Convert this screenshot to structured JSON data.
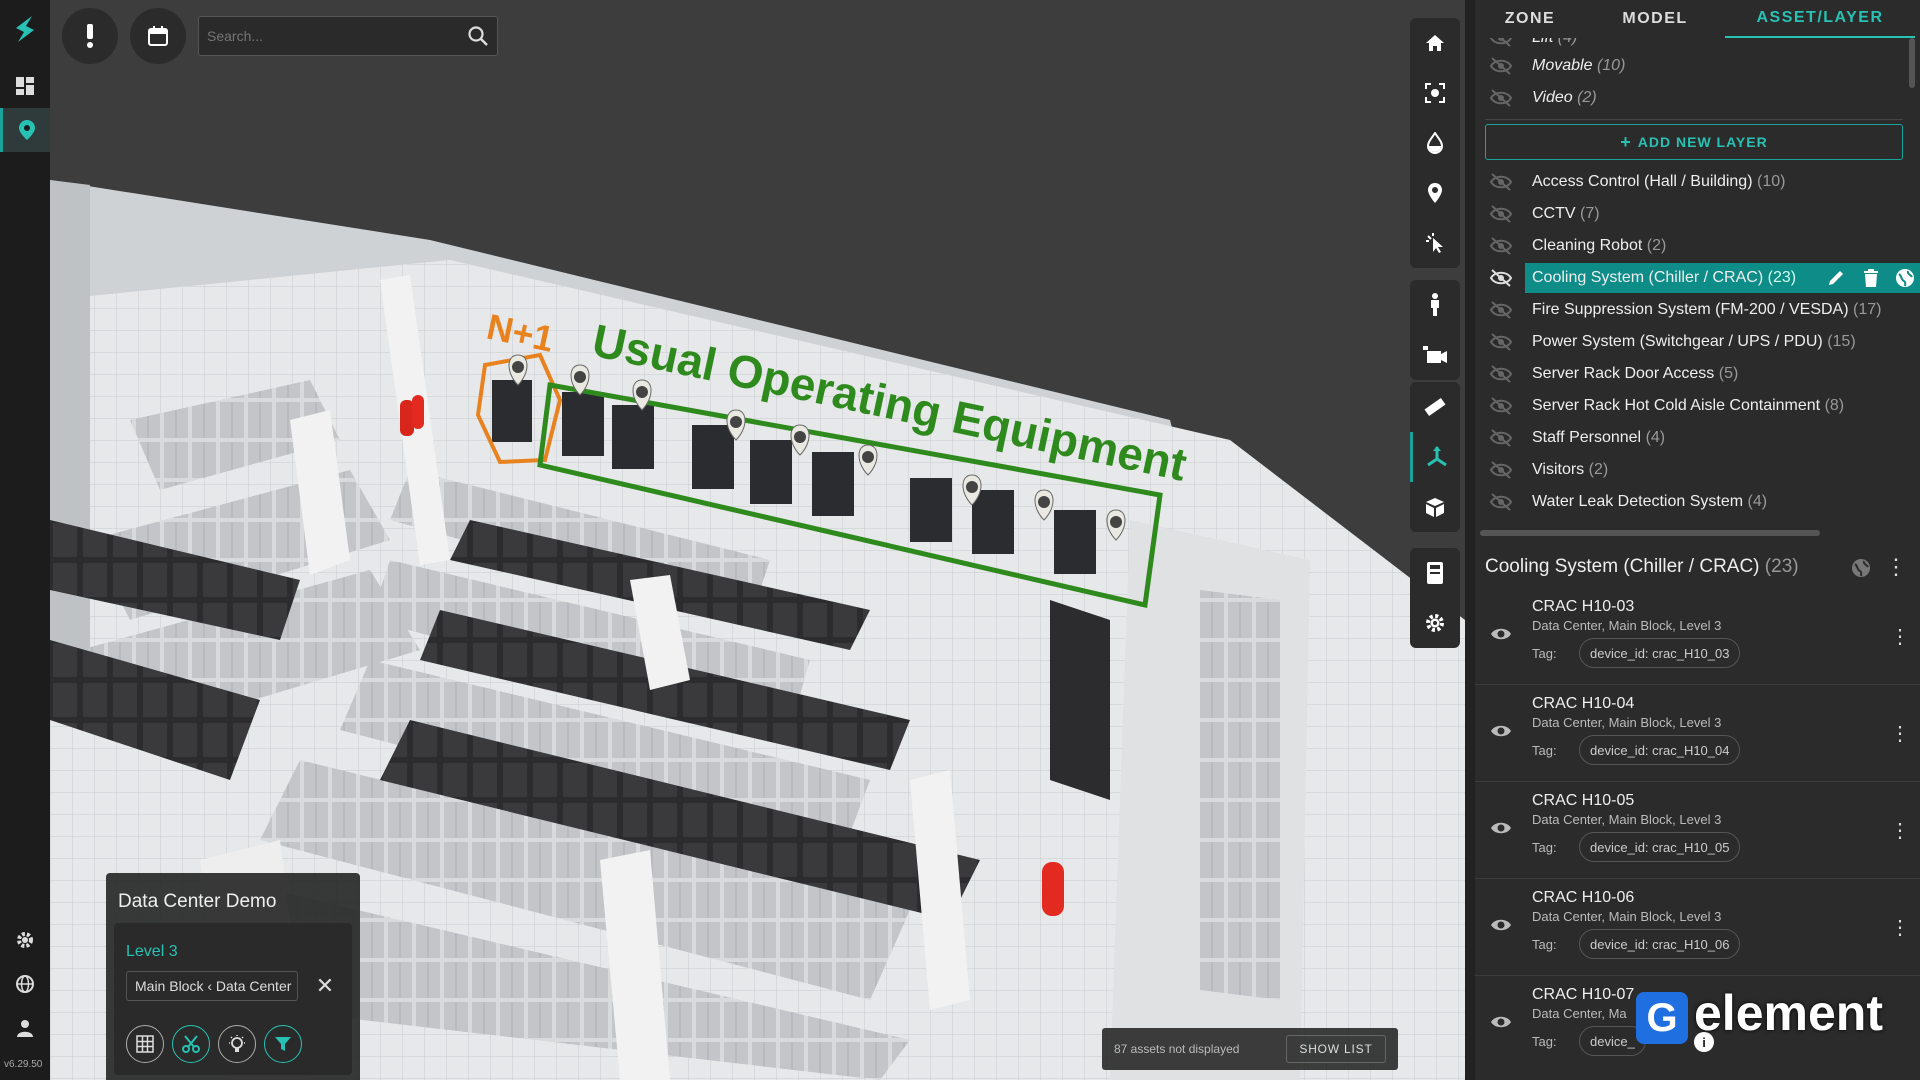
{
  "app": {
    "version": "v6.29.50"
  },
  "rail": {
    "items": [
      "dashboard-icon",
      "location-pin-icon"
    ],
    "bottom": [
      "settings-icon",
      "globe-icon",
      "user-icon"
    ]
  },
  "topbar": {
    "search_placeholder": "Search..."
  },
  "scene": {
    "annotations": {
      "n1": "N+1",
      "usual": "Usual Operating Equipment"
    },
    "colors": {
      "n1": "#e8821e",
      "usual": "#2f8a1e"
    }
  },
  "map_toolbar": [
    "home-icon",
    "focus-icon",
    "drop-icon",
    "pin-icon",
    "pointer-icon",
    "person-icon",
    "camera-icon",
    "ruler-icon",
    "axis-icon",
    "cube-icon",
    "rack-icon",
    "settings-icon"
  ],
  "site_panel": {
    "title": "Data Center Demo",
    "level": "Level 3",
    "block": "Main Block ‹ Data Center"
  },
  "not_displayed": {
    "text": "87 assets not displayed",
    "button": "SHOW LIST"
  },
  "tabs": [
    "ZONE",
    "MODEL",
    "ASSET/LAYER"
  ],
  "layers_top": [
    {
      "name": "Lift",
      "count": "(4)"
    },
    {
      "name": "Movable",
      "count": "(10)"
    },
    {
      "name": "Video",
      "count": "(2)"
    }
  ],
  "add_layer": "ADD NEW LAYER",
  "layers": [
    {
      "name": "Access Control (Hall / Building)",
      "count": "(10)"
    },
    {
      "name": "CCTV",
      "count": "(7)"
    },
    {
      "name": "Cleaning Robot",
      "count": "(2)"
    },
    {
      "name": "Cooling System (Chiller / CRAC)",
      "count": "(23)"
    },
    {
      "name": "Fire Suppression System (FM-200 / VESDA)",
      "count": "(17)"
    },
    {
      "name": "Power System (Switchgear / UPS / PDU)",
      "count": "(15)"
    },
    {
      "name": "Server Rack Door Access",
      "count": "(5)"
    },
    {
      "name": "Server Rack Hot Cold Aisle Containment",
      "count": "(8)"
    },
    {
      "name": "Staff Personnel",
      "count": "(4)"
    },
    {
      "name": "Visitors",
      "count": "(2)"
    },
    {
      "name": "Water Leak Detection System",
      "count": "(4)"
    }
  ],
  "selected_group": {
    "title": "Cooling System (Chiller / CRAC)",
    "count": "(23)"
  },
  "assets": [
    {
      "name": "CRAC H10-03",
      "path": "Data Center, Main Block, Level 3",
      "tag_label": "Tag:",
      "tag": "device_id: crac_H10_03"
    },
    {
      "name": "CRAC H10-04",
      "path": "Data Center, Main Block, Level 3",
      "tag_label": "Tag:",
      "tag": "device_id: crac_H10_04"
    },
    {
      "name": "CRAC H10-05",
      "path": "Data Center, Main Block, Level 3",
      "tag_label": "Tag:",
      "tag": "device_id: crac_H10_05"
    },
    {
      "name": "CRAC H10-06",
      "path": "Data Center, Main Block, Level 3",
      "tag_label": "Tag:",
      "tag": "device_id: crac_H10_06"
    },
    {
      "name": "CRAC H10-07",
      "path": "Data Center, Ma",
      "tag_label": "Tag:",
      "tag": "device_"
    }
  ],
  "watermark": {
    "letter": "G",
    "text": "element"
  },
  "accent": "#1aa39a"
}
